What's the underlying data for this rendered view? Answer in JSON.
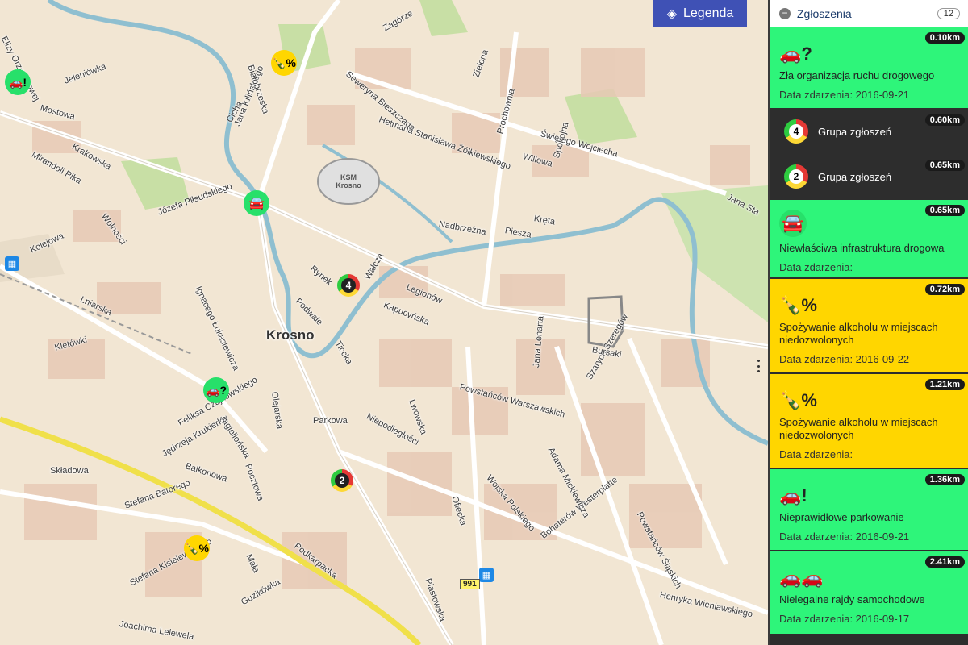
{
  "map": {
    "city_label": "Krosno",
    "stadium_label": [
      "KSM",
      "Krosno"
    ],
    "road_number": "991",
    "legend_label": "Legenda",
    "streets": [
      "Elizy Orzeszkowej",
      "Jeleniówka",
      "Mostowa",
      "Krakowska",
      "Mirandoli Pika",
      "Wolności",
      "Józefa Piłsudskiego",
      "Kolejowa",
      "Lniarska",
      "Kletówki",
      "Ignacego Łukasiewicza",
      "Feliksa Czajkowskiego",
      "Jagiellońska",
      "Jędrzeja Krukierka",
      "Balkonowa",
      "Składowa",
      "Stefana Batorego",
      "Stefana Kisielewskiego",
      "Mała",
      "Guzikówka",
      "Joachima Lelewela",
      "Podkarpacka",
      "Pocztowa",
      "Olejarska",
      "Parkowa",
      "Niepodległości",
      "Lwowska",
      "Podwale",
      "Ticcka",
      "Rynek",
      "Wałcza",
      "Kapucyńska",
      "Legionów",
      "Piastowska",
      "Wojska Polskiego",
      "Ofiecka",
      "Bohaterów Westerplatte",
      "Adama Mickiewicza",
      "Powstańców Warszawskich",
      "Jana Lenarta",
      "Szarych Szeregów",
      "Bursaki",
      "Powstańców Śląskich",
      "Henryka Wieniawskiego",
      "Jana Kilińskiego",
      "Białobrzeska",
      "Cicha",
      "Zagórze",
      "Seweryna Bieszczada",
      "Hetmana Stanisława Żółkiewskiego",
      "Zielona",
      "Prochownia",
      "Świętego Wojciecha",
      "Willowa",
      "Spokojna",
      "Nadbrzeżna",
      "Piesza",
      "Kręta",
      "Jana Sta"
    ]
  },
  "sidebar": {
    "title": "Zgłoszenia",
    "count": "12",
    "date_prefix": "Data zdarzenia:",
    "items": [
      {
        "type": "single",
        "color": "green",
        "icon": "car-question-icon",
        "name": "Zła organizacja ruchu drogowego",
        "date": "Data zdarzenia: 2016-09-21",
        "distance": "0.10km"
      },
      {
        "type": "group",
        "color": "dark",
        "count": "4",
        "name": "Grupa zgłoszeń",
        "distance": "0.60km"
      },
      {
        "type": "group",
        "color": "dark",
        "count": "2",
        "name": "Grupa zgłoszeń",
        "distance": "0.65km"
      },
      {
        "type": "single",
        "color": "green",
        "icon": "car-crash-icon",
        "name": "Niewłaściwa infrastruktura drogowa",
        "date": "Data zdarzenia:",
        "distance": "0.65km"
      },
      {
        "type": "single",
        "color": "yellow",
        "icon": "bottle-percent-icon",
        "name": "Spożywanie alkoholu w miejscach niedozwolonych",
        "date": "Data zdarzenia: 2016-09-22",
        "distance": "0.72km"
      },
      {
        "type": "single",
        "color": "yellow",
        "icon": "bottle-percent-icon",
        "name": "Spożywanie alkoholu w miejscach niedozwolonych",
        "date": "Data zdarzenia:",
        "distance": "1.21km"
      },
      {
        "type": "single",
        "color": "green",
        "icon": "car-parking-icon",
        "name": "Nieprawidłowe parkowanie",
        "date": "Data zdarzenia: 2016-09-21",
        "distance": "1.36km"
      },
      {
        "type": "single",
        "color": "green",
        "icon": "car-race-icon",
        "name": "Nielegalne rajdy samochodowe",
        "date": "Data zdarzenia: 2016-09-17",
        "distance": "2.41km"
      }
    ]
  },
  "markers": {
    "cluster_a": "4",
    "cluster_b": "2",
    "percent": "%",
    "question": "?",
    "exclaim": "!"
  },
  "colors": {
    "green": "#2ef57a",
    "yellow": "#ffd600",
    "dark": "#2d2d2d",
    "legend": "#3f51b5",
    "river": "#8fbfd0"
  }
}
